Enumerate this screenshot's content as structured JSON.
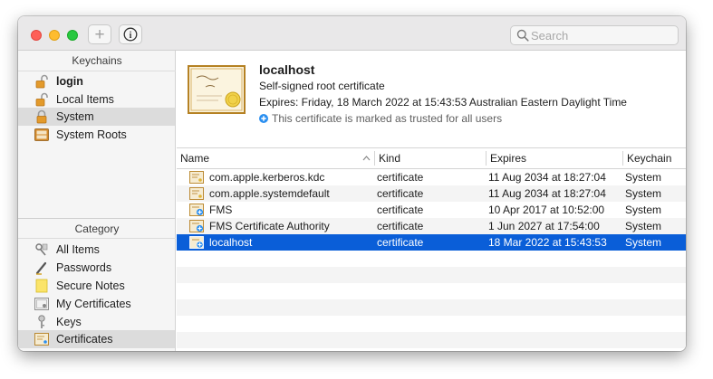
{
  "toolbar": {
    "add_label": "+",
    "info_label": "i",
    "search_placeholder": "Search"
  },
  "sidebar": {
    "keychains_header": "Keychains",
    "keychains": [
      {
        "label": "login",
        "icon": "lock-open-icon",
        "bold": true
      },
      {
        "label": "Local Items",
        "icon": "lock-open-icon"
      },
      {
        "label": "System",
        "icon": "lock-closed-icon",
        "selected": true
      },
      {
        "label": "System Roots",
        "icon": "cabinet-icon"
      }
    ],
    "category_header": "Category",
    "categories": [
      {
        "label": "All Items",
        "icon": "all-items-icon"
      },
      {
        "label": "Passwords",
        "icon": "pen-icon"
      },
      {
        "label": "Secure Notes",
        "icon": "note-icon"
      },
      {
        "label": "My Certificates",
        "icon": "my-certificate-icon"
      },
      {
        "label": "Keys",
        "icon": "key-icon"
      },
      {
        "label": "Certificates",
        "icon": "certificate-icon",
        "selected": true
      }
    ]
  },
  "detail": {
    "title": "localhost",
    "subtitle": "Self-signed root certificate",
    "expires": "Expires: Friday, 18 March 2022 at 15:43:53 Australian Eastern Daylight Time",
    "trust": "This certificate is marked as trusted for all users"
  },
  "table": {
    "columns": [
      "Name",
      "Kind",
      "Expires",
      "Keychain"
    ],
    "rows": [
      {
        "name": "com.apple.kerberos.kdc",
        "kind": "certificate",
        "expires": "11 Aug 2034 at 18:27:04",
        "keychain": "System",
        "icon": "certificate-icon"
      },
      {
        "name": "com.apple.systemdefault",
        "kind": "certificate",
        "expires": "11 Aug 2034 at 18:27:04",
        "keychain": "System",
        "icon": "certificate-icon"
      },
      {
        "name": "FMS",
        "kind": "certificate",
        "expires": "10 Apr 2017 at 10:52:00",
        "keychain": "System",
        "icon": "trusted-certificate-icon"
      },
      {
        "name": "FMS Certificate Authority",
        "kind": "certificate",
        "expires": "1 Jun 2027 at 17:54:00",
        "keychain": "System",
        "icon": "trusted-certificate-icon"
      },
      {
        "name": "localhost",
        "kind": "certificate",
        "expires": "18 Mar 2022 at 15:43:53",
        "keychain": "System",
        "icon": "trusted-certificate-icon",
        "selected": true
      }
    ]
  },
  "colors": {
    "selection": "#0a5ed8",
    "sidebar_selection": "#dcdcdc",
    "trust_badge": "#2b8ff0"
  }
}
